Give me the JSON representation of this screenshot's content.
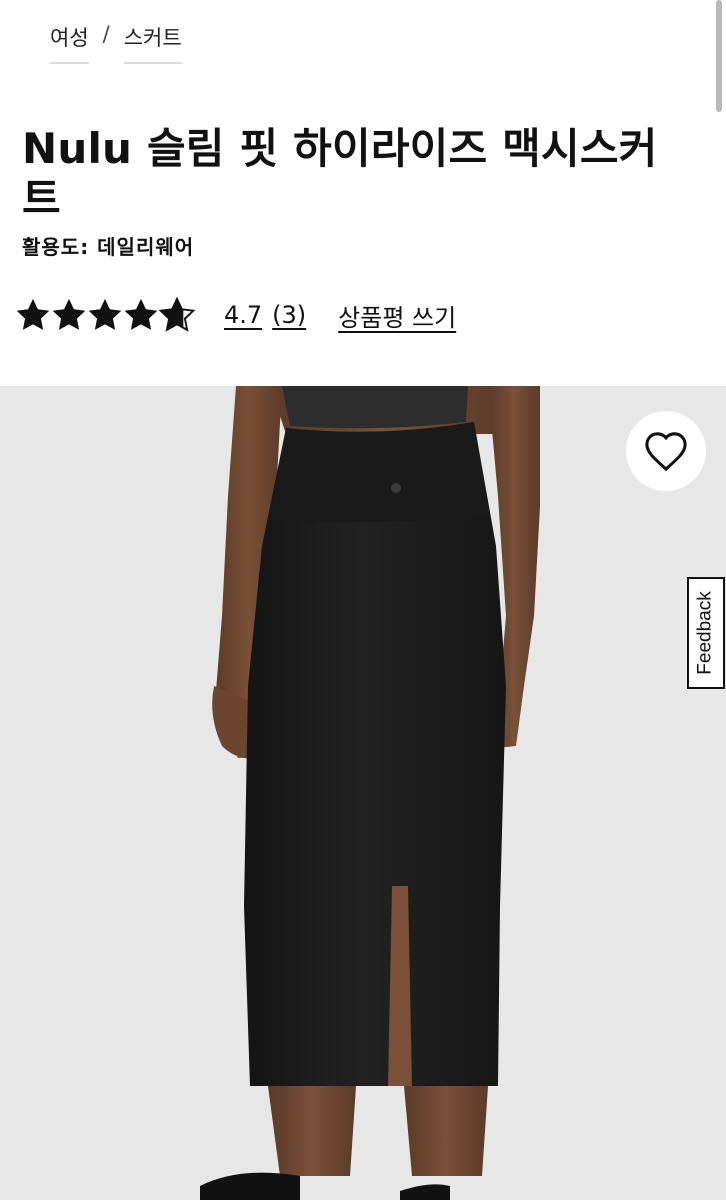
{
  "breadcrumb": {
    "items": [
      "여성",
      "스커트"
    ],
    "separator": "/"
  },
  "product": {
    "title": "Nulu 슬림 핏 하이라이즈 맥시스커트",
    "activity": "활용도: 데일리웨어",
    "rating": {
      "stars": 4.7,
      "score": "4.7",
      "count": "(3)",
      "write_review": "상품평 쓰기"
    }
  },
  "image": {
    "description_icon": "product-photo",
    "favorite_icon": "heart-icon"
  },
  "feedback_tab": {
    "label": "Feedback"
  },
  "colors": {
    "text": "#111111",
    "image_bg": "#e6e6e6",
    "skirt": "#1a1a1a"
  }
}
